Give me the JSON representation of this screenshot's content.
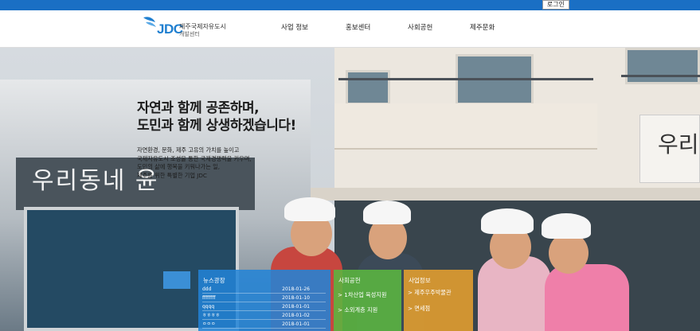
{
  "top": {
    "login_label": "로그인"
  },
  "logo": {
    "mark": "JDC",
    "line1": "제주국제자유도시",
    "line2": "개발센터"
  },
  "nav": [
    {
      "label": "사업 정보"
    },
    {
      "label": "홍보센터"
    },
    {
      "label": "사회공헌"
    },
    {
      "label": "제주문화"
    }
  ],
  "hero": {
    "headline1": "자연과 함께 공존하며,",
    "headline2": "도민과 함께 상생하겠습니다!",
    "sub1": "자연환경, 문화, 제주 고유의 가치를 높이고",
    "sub2": "국제자유도시 조성을 통한 국제경쟁력을 키우며,",
    "sub3": "도민의 삶에 행복을 키워나가는 일,",
    "sub4": "제주를 위한 특별한 기업 JDC",
    "left_sign": "우리동네 윤",
    "right_sign": "우리"
  },
  "news": {
    "title": "뉴스광장",
    "items": [
      {
        "title": "ddd",
        "date": "2018-01-26"
      },
      {
        "title": "ffffffff",
        "date": "2018-01-10"
      },
      {
        "title": "qqqq",
        "date": "2018-01-01"
      },
      {
        "title": "ㅎㅎㅎㅎ",
        "date": "2018-01-02"
      },
      {
        "title": "ㅇㅇㅇ",
        "date": "2018-01-01"
      }
    ]
  },
  "business": {
    "title": "사회공헌",
    "links": [
      "> 1차산업 육성지원",
      "> 소외계층 지원"
    ]
  },
  "info": {
    "title": "사업정보",
    "links": [
      "> 제주우주박물관",
      "> 면세점"
    ]
  }
}
